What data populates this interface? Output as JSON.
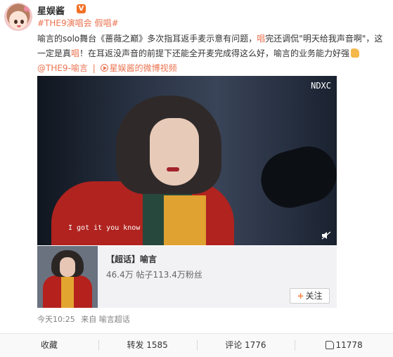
{
  "user": {
    "name": "星娱酱",
    "badge": "V"
  },
  "topics": [
    "#THE9演唱会",
    "假唱#"
  ],
  "text": {
    "p1": "喻言的solo舞台《蔷薇之巅》多次指耳返手麦示意有问题，",
    "h1": "唱",
    "p2": "完还调侃\"明天给我声音啊\"，这一定是真",
    "h2": "唱",
    "p3": "！在耳返没声音的前提下还能全开麦完成得这么好，喻言的业务能力好强"
  },
  "mentions": {
    "at": "@THE9-喻言",
    "sep": "|",
    "video_link": "星娱酱的微博视频"
  },
  "video": {
    "logo": "NDXC",
    "subtitle": "I got it you know"
  },
  "card": {
    "title": "【超话】喻言",
    "stats": "46.4万 帖子113.4万粉丝",
    "follow_label": "关注",
    "follow_plus": "+"
  },
  "meta": {
    "time": "今天10:25",
    "from_label": "来自",
    "source": "喻言超话"
  },
  "actions": {
    "favorite": "收藏",
    "repost": "转发 1585",
    "comment": "评论 1776",
    "like": "11778"
  },
  "colors": {
    "accent": "#eb7350",
    "badge": "#f27026",
    "text": "#333333",
    "muted": "#808080"
  },
  "icons": {
    "thumbs_up_emoji": "thumbs-up-emoji",
    "play": "play-circle-icon",
    "mute": "mute-icon",
    "like": "like-icon"
  }
}
